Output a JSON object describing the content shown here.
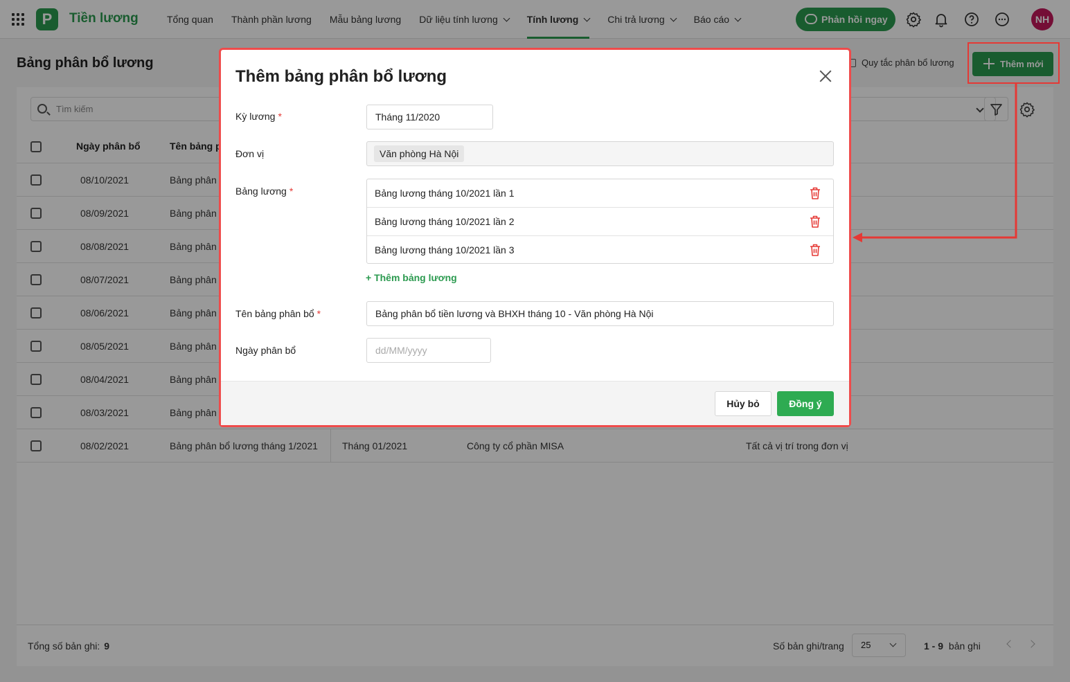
{
  "app": {
    "name": "Tiền lương",
    "logo_letter": "P",
    "brand_color": "#2b9a4f"
  },
  "nav": [
    {
      "label": "Tổng quan",
      "dropdown": false,
      "active": false
    },
    {
      "label": "Thành phần lương",
      "dropdown": false,
      "active": false
    },
    {
      "label": "Mẫu bảng lương",
      "dropdown": false,
      "active": false
    },
    {
      "label": "Dữ liệu tính lương",
      "dropdown": true,
      "active": false
    },
    {
      "label": "Tính lương",
      "dropdown": true,
      "active": true
    },
    {
      "label": "Chi trả lương",
      "dropdown": true,
      "active": false
    },
    {
      "label": "Báo cáo",
      "dropdown": true,
      "active": false
    }
  ],
  "header": {
    "feedback_label": "Phản hồi ngay",
    "avatar_initials": "NH",
    "avatar_color": "#c2185b",
    "icons": [
      "settings-icon",
      "bell-icon",
      "help-icon",
      "more-icon"
    ]
  },
  "page": {
    "title": "Bảng phân bổ lương",
    "rule_link": "Quy tắc phân bổ lương",
    "add_label": "Thêm mới",
    "search_placeholder": "Tìm kiếm"
  },
  "table": {
    "headers": {
      "date": "Ngày phân bổ",
      "name": "Tên bảng p"
    },
    "rows": [
      {
        "date": "08/10/2021",
        "name": "Bảng phân"
      },
      {
        "date": "08/09/2021",
        "name": "Bảng phân"
      },
      {
        "date": "08/08/2021",
        "name": "Bảng phân"
      },
      {
        "date": "08/07/2021",
        "name": "Bảng phân"
      },
      {
        "date": "08/06/2021",
        "name": "Bảng phân"
      },
      {
        "date": "08/05/2021",
        "name": "Bảng phân"
      },
      {
        "date": "08/04/2021",
        "name": "Bảng phân"
      },
      {
        "date": "08/03/2021",
        "name": "Bảng phân"
      }
    ],
    "last_row": {
      "date": "08/02/2021",
      "name": "Bảng phân bổ lương tháng 1/2021",
      "period": "Tháng 01/2021",
      "unit": "Công ty cổ phần MISA",
      "position": "Tất cả vị trí trong đơn vị"
    }
  },
  "footer": {
    "total_label": "Tổng số bản ghi:",
    "total_value": "9",
    "per_page_label": "Số bản ghi/trang",
    "per_page_value": "25",
    "range_bold": "1 - 9",
    "range_suffix": "bản ghi"
  },
  "modal": {
    "title": "Thêm bảng phân bổ lương",
    "fields": {
      "period_label": "Kỳ lương",
      "period_value": "Tháng 11/2020",
      "unit_label": "Đơn vị",
      "unit_value": "Văn phòng Hà Nội",
      "payroll_label": "Bảng lương",
      "payrolls": [
        "Bảng lương tháng 10/2021 lần 1",
        "Bảng lương tháng 10/2021 lần 2",
        "Bảng lương tháng 10/2021 lần 3"
      ],
      "add_payroll_label": "+ Thêm bảng lương",
      "name_label": "Tên bảng phân bổ",
      "name_value": "Bảng phân bổ tiền lương và BHXH tháng 10 - Văn phòng Hà Nội",
      "date_label": "Ngày phân bổ",
      "date_placeholder": "dd/MM/yyyy"
    },
    "cancel_label": "Hủy bỏ",
    "ok_label": "Đồng ý"
  },
  "annotation_color": "#e53935"
}
